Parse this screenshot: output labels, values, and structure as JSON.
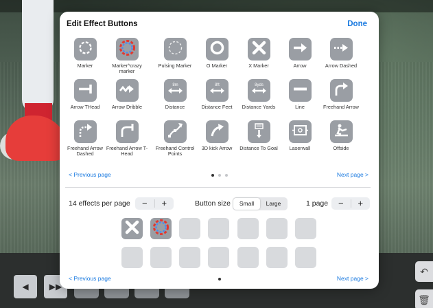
{
  "background": {
    "dock_buttons": [
      {
        "icon": "prev-frame-icon",
        "glyph": "◀"
      },
      {
        "icon": "next-frame-icon",
        "glyph": "▶▶"
      }
    ],
    "side_buttons": [
      {
        "icon": "undo-icon",
        "glyph": "↶"
      },
      {
        "icon": "trash-icon",
        "glyph": "🗑"
      }
    ]
  },
  "modal": {
    "title": "Edit Effect Buttons",
    "done_label": "Done",
    "effects": [
      {
        "label": "Marker",
        "icon": "marker-icon"
      },
      {
        "label": "Marker^crazy marker",
        "icon": "crazy-marker-icon"
      },
      {
        "label": "Pulsing Marker",
        "icon": "pulsing-marker-icon"
      },
      {
        "label": "O Marker",
        "icon": "o-marker-icon"
      },
      {
        "label": "X Marker",
        "icon": "x-marker-icon"
      },
      {
        "label": "Arrow",
        "icon": "arrow-icon"
      },
      {
        "label": "Arrow Dashed",
        "icon": "arrow-dashed-icon"
      },
      {
        "label": "Arrow THead",
        "icon": "arrow-thead-icon"
      },
      {
        "label": "Arrow Dribble",
        "icon": "arrow-dribble-icon"
      },
      {
        "label": "Distance",
        "icon": "distance-icon",
        "sub": "8m"
      },
      {
        "label": "Distance Feet",
        "icon": "distance-feet-icon",
        "sub": "8ft"
      },
      {
        "label": "Distance Yards",
        "icon": "distance-yards-icon",
        "sub": "8yds"
      },
      {
        "label": "Line",
        "icon": "line-icon"
      },
      {
        "label": "Freehand Arrow",
        "icon": "freehand-arrow-icon"
      },
      {
        "label": "Freehand Arrow Dashed",
        "icon": "freehand-arrow-dashed-icon"
      },
      {
        "label": "Freehand Arrow T-Head",
        "icon": "freehand-arrow-thead-icon"
      },
      {
        "label": "Freehand Control Points",
        "icon": "freehand-control-points-icon"
      },
      {
        "label": "3D kick Arrow",
        "icon": "3d-kick-arrow-icon"
      },
      {
        "label": "Distance To Goal",
        "icon": "distance-to-goal-icon"
      },
      {
        "label": "Laserwall",
        "icon": "laserwall-icon"
      },
      {
        "label": "Offside",
        "icon": "offside-icon"
      }
    ],
    "top_pager": {
      "prev": "< Previous page",
      "next": "Next page >",
      "pages": 3,
      "current": 1
    },
    "settings": {
      "effects_per_page_label": "14 effects per page",
      "button_size_label": "Button size",
      "size_options": [
        "Small",
        "Large"
      ],
      "size_selected": "Small",
      "pages_label": "1 page",
      "minus": "−",
      "plus": "+"
    },
    "selected_slots": [
      {
        "icon": "x-marker-icon"
      },
      {
        "icon": "crazy-marker-icon"
      }
    ],
    "total_slots": 14,
    "bottom_pager": {
      "prev": "< Previous page",
      "next": "Next page >",
      "pages": 1,
      "current": 1
    },
    "colors": {
      "accent": "#1a7ae0",
      "tile": "#9a9ea4",
      "slot_empty": "#d8dadd"
    }
  }
}
